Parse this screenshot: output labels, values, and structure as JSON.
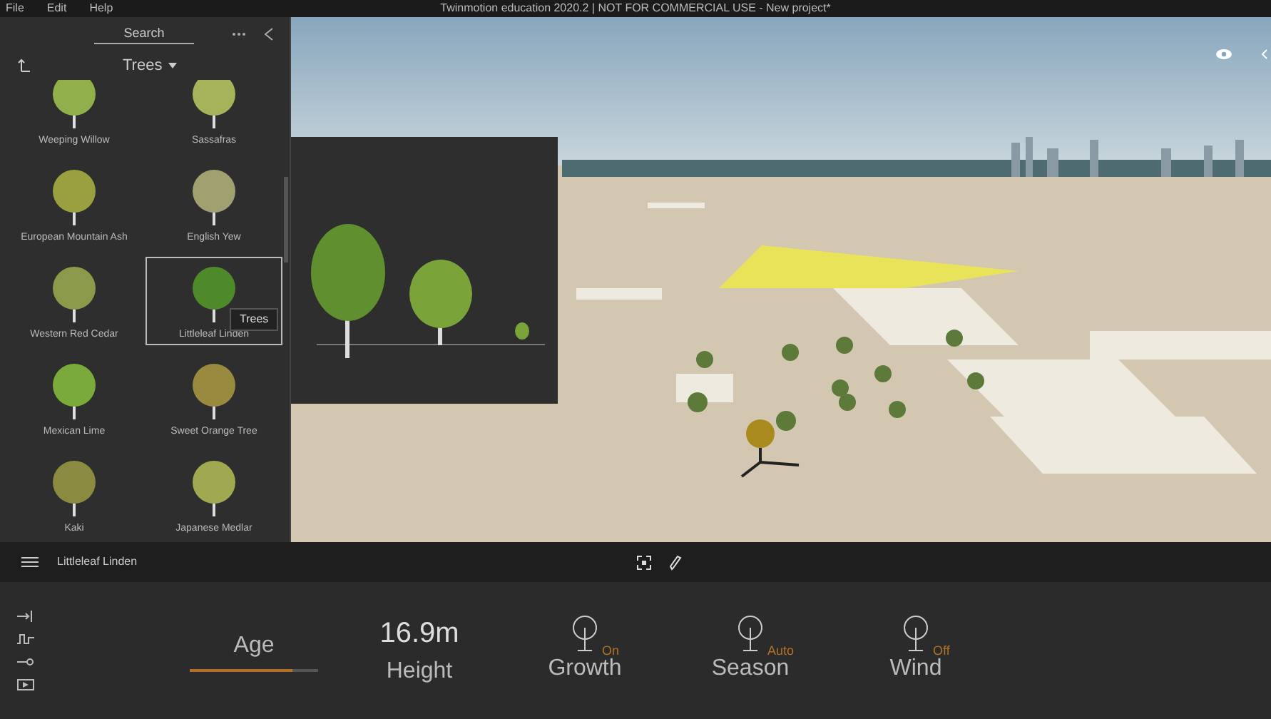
{
  "window": {
    "title": "Twinmotion education 2020.2 | NOT FOR COMMERCIAL USE - New project*"
  },
  "menu": [
    "File",
    "Edit",
    "Help"
  ],
  "library": {
    "search_placeholder": "Search",
    "category": "Trees",
    "items": [
      {
        "label": "Weeping Willow",
        "selected": false
      },
      {
        "label": "Sassafras",
        "selected": false
      },
      {
        "label": "European Mountain Ash",
        "selected": false
      },
      {
        "label": "English Yew",
        "selected": false
      },
      {
        "label": "Western Red Cedar",
        "selected": false
      },
      {
        "label": "Littleleaf Linden",
        "selected": true
      },
      {
        "label": "Mexican Lime",
        "selected": false
      },
      {
        "label": "Sweet Orange Tree",
        "selected": false
      },
      {
        "label": "Kaki",
        "selected": false
      },
      {
        "label": "Japanese Medlar",
        "selected": false
      }
    ]
  },
  "tooltip": "Trees",
  "selection": {
    "name": "Littleleaf Linden"
  },
  "properties": [
    {
      "kind": "slider",
      "label": "Age",
      "level": 0.8
    },
    {
      "kind": "value",
      "label": "Height",
      "value": "16.9m"
    },
    {
      "kind": "toggle",
      "label": "Growth",
      "state": "On"
    },
    {
      "kind": "toggle",
      "label": "Season",
      "state": "Auto"
    },
    {
      "kind": "toggle",
      "label": "Wind",
      "state": "Off"
    }
  ]
}
